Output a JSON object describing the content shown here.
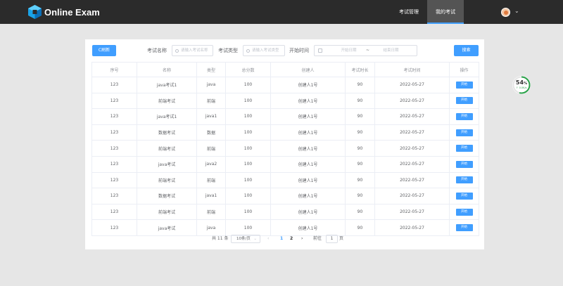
{
  "app": {
    "title": "Online Exam"
  },
  "nav": {
    "items": [
      {
        "label": "考试管理"
      },
      {
        "label": "我的考试"
      }
    ]
  },
  "toolbar": {
    "refresh_label": "C刷新",
    "exam_name_label": "考试名称",
    "exam_name_placeholder": "请输入考试名称",
    "exam_type_label": "考试类型",
    "exam_type_placeholder": "请输入考试类型",
    "start_time_label": "开始时间",
    "start_date_placeholder": "开始日期",
    "range_separator": "~",
    "end_date_placeholder": "结束日期",
    "search_label": "搜索"
  },
  "table": {
    "headers": [
      "序号",
      "名称",
      "类型",
      "总分数",
      "创建人",
      "考试时长",
      "考试时间",
      "操作"
    ],
    "rows": [
      {
        "id": "123",
        "name": "java考试1",
        "type": "java",
        "score": "100",
        "creator": "创建人1号",
        "duration": "90",
        "date": "2022-05-27",
        "action": "开始"
      },
      {
        "id": "123",
        "name": "前端考试",
        "type": "前端",
        "score": "100",
        "creator": "创建人1号",
        "duration": "90",
        "date": "2022-05-27",
        "action": "开始"
      },
      {
        "id": "123",
        "name": "java考试1",
        "type": "java1",
        "score": "100",
        "creator": "创建人1号",
        "duration": "90",
        "date": "2022-05-27",
        "action": "开始"
      },
      {
        "id": "123",
        "name": "数据考试",
        "type": "数据",
        "score": "100",
        "creator": "创建人1号",
        "duration": "90",
        "date": "2022-05-27",
        "action": "开始"
      },
      {
        "id": "123",
        "name": "前端考试",
        "type": "前端",
        "score": "100",
        "creator": "创建人1号",
        "duration": "90",
        "date": "2022-05-27",
        "action": "开始"
      },
      {
        "id": "123",
        "name": "java考试",
        "type": "java2",
        "score": "100",
        "creator": "创建人1号",
        "duration": "90",
        "date": "2022-05-27",
        "action": "开始"
      },
      {
        "id": "123",
        "name": "前端考试",
        "type": "前端",
        "score": "100",
        "creator": "创建人1号",
        "duration": "90",
        "date": "2022-05-27",
        "action": "开始"
      },
      {
        "id": "123",
        "name": "数据考试",
        "type": "java1",
        "score": "100",
        "creator": "创建人1号",
        "duration": "90",
        "date": "2022-05-27",
        "action": "开始"
      },
      {
        "id": "123",
        "name": "前端考试",
        "type": "前端",
        "score": "100",
        "creator": "创建人1号",
        "duration": "90",
        "date": "2022-05-27",
        "action": "开始"
      },
      {
        "id": "123",
        "name": "java考试",
        "type": "java",
        "score": "100",
        "creator": "创建人1号",
        "duration": "90",
        "date": "2022-05-27",
        "action": "开始"
      }
    ]
  },
  "pagination": {
    "total_label": "共 11 条",
    "page_size": "10条/页",
    "prev": "‹",
    "pages": [
      "1",
      "2"
    ],
    "current_page": "1",
    "next": "›",
    "goto_label": "前往",
    "goto_value": "1",
    "page_suffix": "页"
  },
  "progress_widget": {
    "value": "54",
    "unit": "%",
    "subtext": "↑ 0.0K/s",
    "percent": 54
  },
  "colors": {
    "primary": "#409eff",
    "topbar": "#2b2b2b",
    "nav_active": "#545454",
    "progress": "#2aa24a"
  }
}
